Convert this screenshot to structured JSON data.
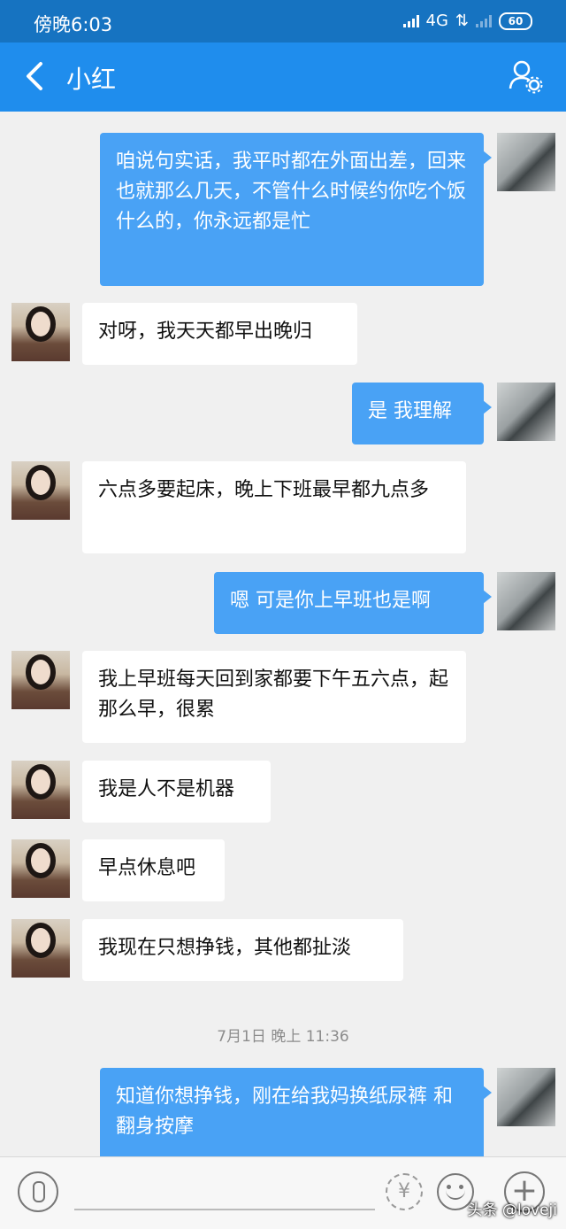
{
  "status": {
    "time": "傍晚6:03",
    "network": "4G",
    "battery": "60"
  },
  "header": {
    "title": "小红",
    "back_icon": "back-arrow-icon",
    "profile_icon": "contact-settings-icon"
  },
  "messages": [
    {
      "side": "out",
      "text": "咱说句实话，我平时都在外面出差，回来也就那么几天，不管什么时候约你吃个饭什么的，你永远都是忙"
    },
    {
      "side": "in",
      "text": "对呀，我天天都早出晚归"
    },
    {
      "side": "out",
      "text": "是  我理解"
    },
    {
      "side": "in",
      "text": "六点多要起床，晚上下班最早都九点多"
    },
    {
      "side": "out",
      "text": "嗯  可是你上早班也是啊"
    },
    {
      "side": "in",
      "text": "我上早班每天回到家都要下午五六点，起那么早，很累"
    },
    {
      "side": "in",
      "text": "我是人不是机器"
    },
    {
      "side": "in",
      "text": "早点休息吧"
    },
    {
      "side": "in",
      "text": "我现在只想挣钱，其他都扯淡"
    },
    {
      "side": "out",
      "text": "知道你想挣钱，刚在给我妈换纸尿裤  和翻身按摩"
    }
  ],
  "timestamp": "7月1日 晚上 11:36",
  "input": {
    "placeholder": ""
  },
  "watermark": "头条 @loveji",
  "colors": {
    "statusbar": "#1673c1",
    "navbar": "#1f8ded",
    "outgoing_bubble": "#49a2f5",
    "incoming_bubble": "#ffffff",
    "background": "#f0f0f0"
  }
}
